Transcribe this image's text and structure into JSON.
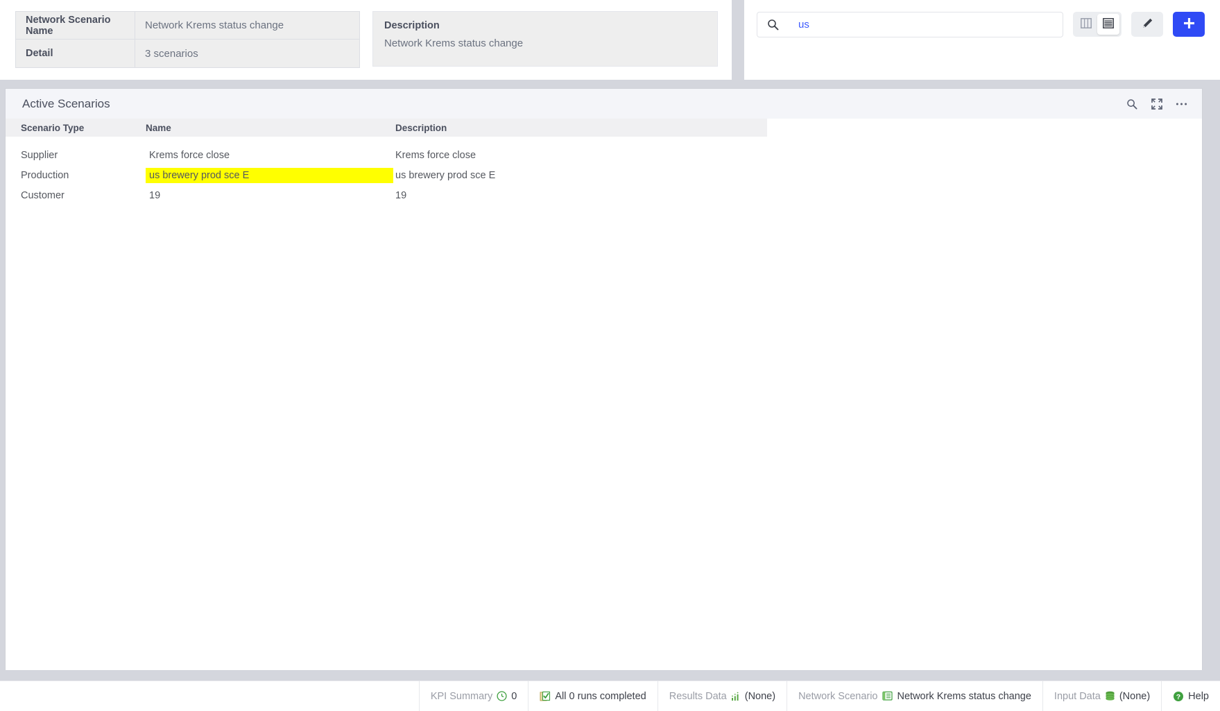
{
  "header": {
    "info_rows": [
      {
        "label": "Network Scenario Name",
        "value": "Network Krems status change"
      },
      {
        "label": "Detail",
        "value": "3 scenarios"
      }
    ],
    "description": {
      "title": "Description",
      "text": "Network Krems status change"
    }
  },
  "toolbar": {
    "search": {
      "value": "us",
      "placeholder": "Search",
      "icon": "search-icon"
    },
    "view_toggle": {
      "column_view": {
        "icon": "columns-view-icon",
        "active": false
      },
      "list_view": {
        "icon": "list-view-icon",
        "active": true
      }
    },
    "edit_button": {
      "icon": "pencil-icon",
      "label": ""
    },
    "add_button": {
      "icon": "plus-icon",
      "label": "+"
    }
  },
  "main": {
    "title": "Active Scenarios",
    "header_icons": [
      {
        "name": "search-icon"
      },
      {
        "name": "expand-icon"
      },
      {
        "name": "more-options-icon"
      }
    ],
    "table": {
      "columns": [
        "Scenario Type",
        "Name",
        "Description"
      ],
      "rows": [
        {
          "type": "Supplier",
          "name": "Krems force close",
          "description": "Krems force close",
          "highlighted": false
        },
        {
          "type": "Production",
          "name": "us brewery prod sce E",
          "description": "us brewery prod sce E",
          "highlighted": true
        },
        {
          "type": "Customer",
          "name": "19",
          "description": "19",
          "highlighted": false
        }
      ]
    }
  },
  "status_bar": {
    "items": [
      {
        "label": "KPI Summary",
        "value": "0",
        "icon": "info-circle-icon"
      },
      {
        "label": "",
        "value": "All 0 runs completed",
        "icon": "checklist-icon"
      },
      {
        "label": "Results Data",
        "value": "(None)",
        "icon": "chart-dots-icon"
      },
      {
        "label": "Network Scenario",
        "value": "Network Krems status change",
        "icon": "scenario-icon"
      },
      {
        "label": "Input Data",
        "value": "(None)",
        "icon": "database-icon"
      },
      {
        "label": "",
        "value": "Help",
        "icon": "help-icon"
      }
    ]
  },
  "colors": {
    "accent_blue": "#2f4af5",
    "search_text": "#3d5afe",
    "highlight_yellow": "#ffff00",
    "page_bg": "#d4d6dd",
    "panel_bg": "#eeeeee",
    "card_header_bg": "#f4f5f9",
    "status_green": "#3fa03f"
  }
}
